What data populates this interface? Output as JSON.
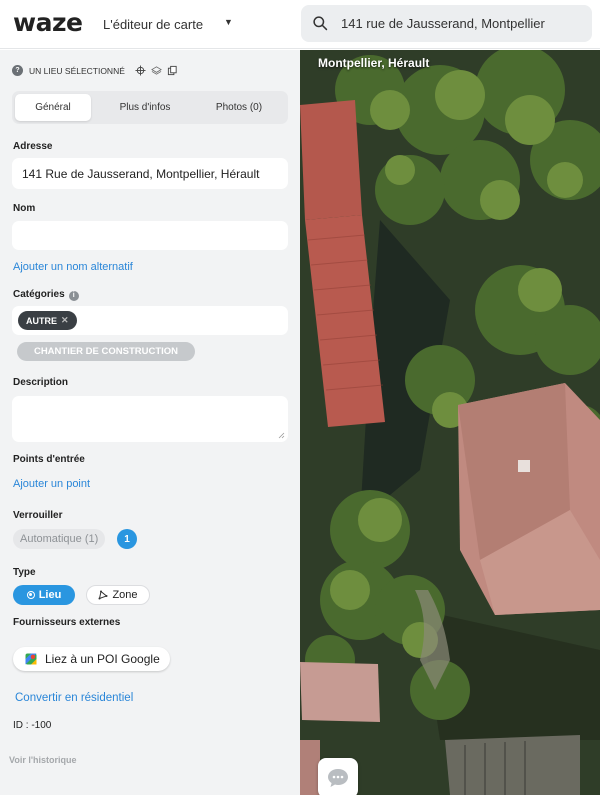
{
  "topbar": {
    "logo_text": "waze",
    "app_title": "L'éditeur de carte",
    "search_value": "141 rue de Jausserand, Montpellier"
  },
  "panel": {
    "selection_label": "UN LIEU SÉLECTIONNÉ",
    "tabs": [
      {
        "label": "Général",
        "active": true
      },
      {
        "label": "Plus d'infos",
        "active": false
      },
      {
        "label": "Photos (0)",
        "active": false
      }
    ],
    "address_label": "Adresse",
    "address_value": "141 Rue de Jausserand, Montpellier, Hérault",
    "name_label": "Nom",
    "name_value": "",
    "add_alt_name": "Ajouter un nom alternatif",
    "categories_label": "Catégories",
    "category_selected": "AUTRE",
    "category_suggestion": "CHANTIER DE CONSTRUCTION",
    "description_label": "Description",
    "description_value": "",
    "entry_points_label": "Points d'entrée",
    "add_point": "Ajouter un point",
    "lock_label": "Verrouiller",
    "lock_auto": "Automatique (1)",
    "lock_level": "1",
    "type_label": "Type",
    "type_lieu": "Lieu",
    "type_zone": "Zone",
    "providers_label": "Fournisseurs externes",
    "google_button": "Liez à un POI Google",
    "convert_residential": "Convertir en résidentiel",
    "id_text": "ID : -100",
    "history_link": "Voir l'historique"
  },
  "map": {
    "location_label": "Montpellier, Hérault"
  },
  "colors": {
    "accent": "#2a96e0",
    "link": "#2a86d8",
    "panel_bg": "#f2f3f4"
  }
}
